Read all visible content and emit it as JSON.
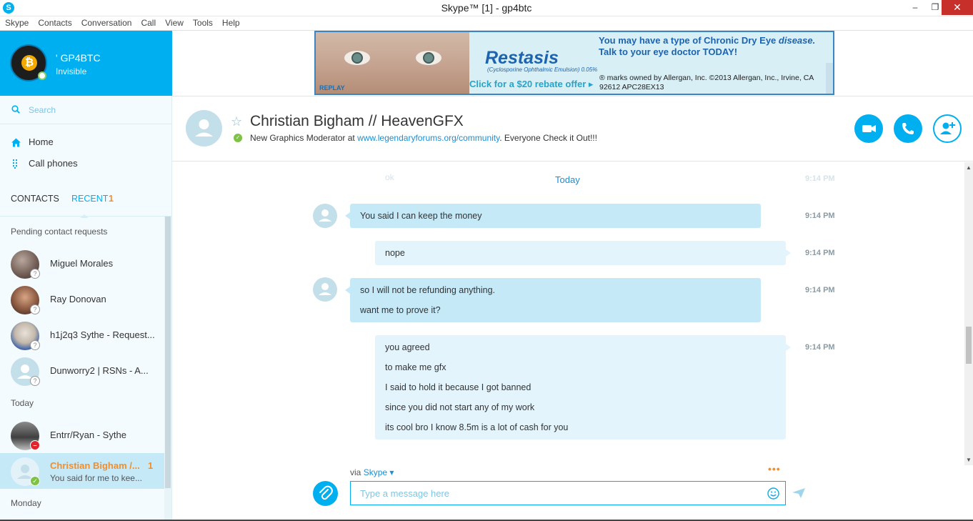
{
  "window": {
    "title": "Skype™ [1] - gp4btc",
    "minimize": "–",
    "maximize": "❐",
    "close": "✕"
  },
  "menu": [
    "Skype",
    "Contacts",
    "Conversation",
    "Call",
    "View",
    "Tools",
    "Help"
  ],
  "profile": {
    "name": "' GP4BTC",
    "status": "Invisible"
  },
  "search": {
    "placeholder": "Search"
  },
  "nav": [
    {
      "label": "Home",
      "icon": "home-icon"
    },
    {
      "label": "Call phones",
      "icon": "dialpad-icon"
    }
  ],
  "tabs": {
    "contacts": "CONTACTS",
    "recent": "RECENT",
    "recent_count": "1"
  },
  "sections": {
    "pending": "Pending contact requests",
    "today": "Today",
    "monday": "Monday"
  },
  "pending_contacts": [
    {
      "name": "Miguel Morales"
    },
    {
      "name": "Ray Donovan"
    },
    {
      "name": "h1j2q3 Sythe - Request..."
    },
    {
      "name": "Dunworry2 | RSNs  - A..."
    }
  ],
  "today_contacts": [
    {
      "name": "Entrr/Ryan - Sythe"
    }
  ],
  "active_contact": {
    "name": "Christian Bigham /...",
    "count": "1",
    "preview": "You said for me to kee..."
  },
  "ad": {
    "replay": "REPLAY",
    "brand": "Restasis",
    "brand_sub": "(Cyclosporine Ophthalmic Emulsion) 0.05%",
    "rebate": "Click for a $20 rebate offer ▸",
    "headline1": "You may have a type of Chronic Dry Eye",
    "headline1_em": "disease.",
    "headline2": "Talk to your eye doctor TODAY!",
    "legal": "® marks owned by Allergan, Inc. ©2013 Allergan, Inc., Irvine, CA 92612 APC28EX13"
  },
  "conversation": {
    "name": "Christian Bigham // HeavenGFX",
    "mood_prefix": "New Graphics Moderator at ",
    "mood_link": "www.legendaryforums.org/community",
    "mood_suffix": ". Everyone Check it Out!!!"
  },
  "messages": {
    "faded_text": "ok",
    "faded_time": "9:14 PM",
    "day_label": "Today",
    "items": [
      {
        "direction": "in",
        "lines": [
          "You said I can keep the money"
        ],
        "time": "9:14 PM"
      },
      {
        "direction": "out",
        "lines": [
          "nope"
        ],
        "time": "9:14 PM"
      },
      {
        "direction": "in",
        "lines": [
          "so I will not be refunding anything.",
          "want me to prove it?"
        ],
        "time": "9:14 PM"
      },
      {
        "direction": "out",
        "lines": [
          "you agreed",
          "to make me gfx",
          "I said to hold it because I got banned",
          "since you did not start any of my work",
          "its cool bro I know 8.5m is a lot of cash for you"
        ],
        "time": "9:14 PM"
      }
    ]
  },
  "composer": {
    "via_prefix": "via ",
    "via_service": "Skype ▾",
    "more": "•••",
    "placeholder": "Type a message here"
  },
  "colors": {
    "accent": "#00aff0",
    "unread": "#f68d26",
    "bubble_in": "#c6e9f8",
    "bubble_out": "#e3f4fc"
  }
}
